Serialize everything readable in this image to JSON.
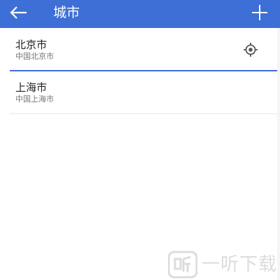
{
  "appbar": {
    "title": "城市",
    "back_icon": "arrow-left-icon",
    "add_icon": "plus-icon",
    "color": "#3d6fd6"
  },
  "cities": [
    {
      "name": "北京市",
      "subtitle": "中国北京市",
      "current_location": true,
      "icon": "locate-icon"
    },
    {
      "name": "上海市",
      "subtitle": "中国上海市",
      "current_location": false
    }
  ],
  "watermark": {
    "text": "一听下载",
    "logo": "watermark-logo-icon"
  }
}
